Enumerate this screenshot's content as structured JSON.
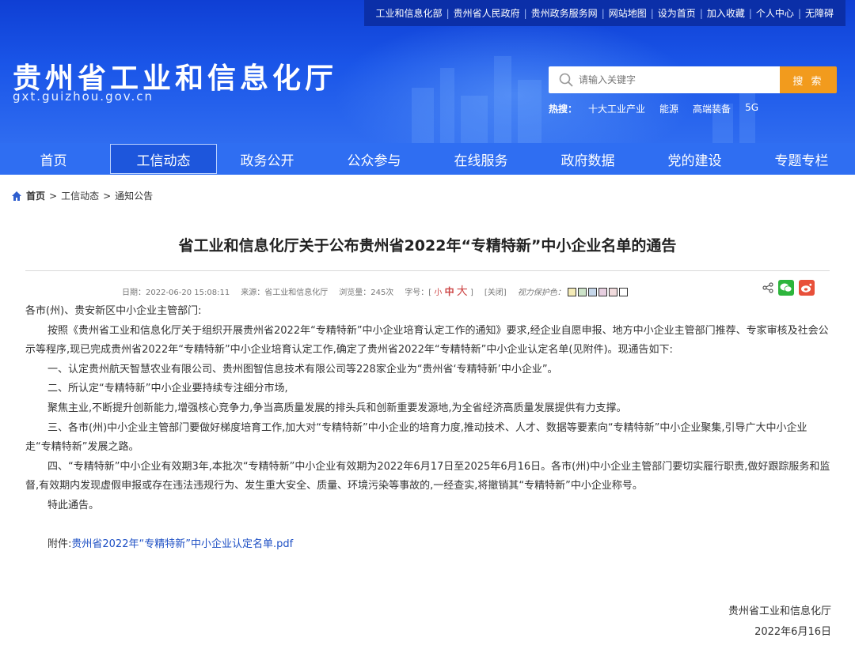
{
  "header": {
    "top_links": [
      "工业和信息化部",
      "贵州省人民政府",
      "贵州政务服务网",
      "网站地图",
      "设为首页",
      "加入收藏",
      "个人中心",
      "无障碍"
    ],
    "title": "贵州省工业和信息化厅",
    "domain": "gxt.guizhou.gov.cn",
    "search": {
      "placeholder": "请输入关键字",
      "button_label": "搜 索"
    },
    "hot": {
      "label": "热搜：",
      "terms": [
        "十大工业产业",
        "能源",
        "高端装备",
        "5G"
      ]
    }
  },
  "nav": {
    "items": [
      "首页",
      "工信动态",
      "政务公开",
      "公众参与",
      "在线服务",
      "政府数据",
      "党的建设",
      "专题专栏"
    ],
    "active_index": 1
  },
  "breadcrumb": {
    "home": "首页",
    "sep": ">",
    "items": [
      "工信动态",
      "通知公告"
    ]
  },
  "article": {
    "title": "省工业和信息化厅关于公布贵州省2022年“专精特新”中小企业名单的通告",
    "meta": {
      "date": "日期：2022-06-20 15:08:11",
      "source": "来源：省工业和信息化厅",
      "views": "浏览量：245次",
      "font_size_label": "字号：[",
      "font_small": "小",
      "font_mid": "中",
      "font_big": "大",
      "font_close": "]",
      "close": "[关闭]",
      "eye_label": "视力保护色："
    },
    "swatch_colors": [
      "#f5ecb8",
      "#cde3c9",
      "#c6d7ea",
      "#e7cfe0",
      "#f1dbdd",
      "#ffffff"
    ],
    "paragraphs": [
      "各市(州)、贵安新区中小企业主管部门:",
      "按照《贵州省工业和信息化厅关于组织开展贵州省2022年“专精特新”中小企业培育认定工作的通知》要求,经企业自愿申报、地方中小企业主管部门推荐、专家审核及社会公示等程序,现已完成贵州省2022年“专精特新”中小企业培育认定工作,确定了贵州省2022年“专精特新”中小企业认定名单(见附件)。现通告如下:",
      "一、认定贵州航天智慧农业有限公司、贵州图智信息技术有限公司等228家企业为“贵州省‘专精特新’中小企业”。",
      "二、所认定“专精特新”中小企业要持续专注细分市场,",
      "聚焦主业,不断提升创新能力,增强核心竞争力,争当高质量发展的排头兵和创新重要发源地,为全省经济高质量发展提供有力支撑。",
      "三、各市(州)中小企业主管部门要做好梯度培育工作,加大对“专精特新”中小企业的培育力度,推动技术、人才、数据等要素向“专精特新”中小企业聚集,引导广大中小企业走“专精特新”发展之路。",
      "四、“专精特新”中小企业有效期3年,本批次“专精特新”中小企业有效期为2022年6月17日至2025年6月16日。各市(州)中小企业主管部门要切实履行职责,做好跟踪服务和监督,有效期内发现虚假申报或存在违法违规行为、发生重大安全、质量、环境污染等事故的,一经查实,将撤销其“专精特新”中小企业称号。",
      "特此通告。"
    ],
    "attachment": {
      "label": "附件:",
      "link": "贵州省2022年“专精特新”中小企业认定名单.pdf"
    },
    "signature_org": "贵州省工业和信息化厅",
    "signature_date": "2022年6月16日"
  },
  "colors": {
    "header_blue": "#1a55e8",
    "nav_blue": "#2f6ef2",
    "search_button": "#f29b1d",
    "link": "#1d4fc4"
  }
}
